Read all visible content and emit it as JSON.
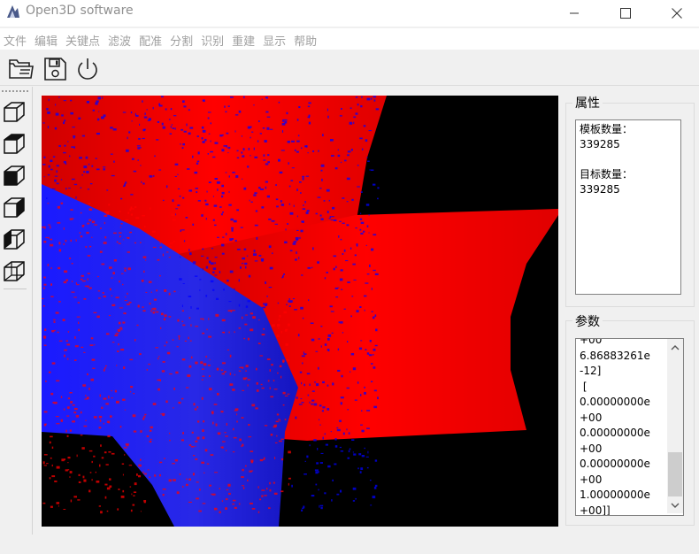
{
  "window": {
    "title": "Open3D software",
    "app_icon": "open3d-logo-icon",
    "controls": [
      "minimize-icon",
      "maximize-icon",
      "close-icon"
    ]
  },
  "menu": [
    "文件",
    "编辑",
    "关键点",
    "滤波",
    "配准",
    "分割",
    "识别",
    "重建",
    "显示",
    "帮助"
  ],
  "toolbar": {
    "buttons": [
      {
        "name": "open-folder-icon"
      },
      {
        "name": "save-disk-icon"
      },
      {
        "name": "power-icon"
      }
    ]
  },
  "view_buttons": [
    {
      "name": "cube-view-1-icon"
    },
    {
      "name": "cube-view-2-icon"
    },
    {
      "name": "cube-view-3-icon"
    },
    {
      "name": "cube-view-4-icon"
    },
    {
      "name": "cube-view-5-icon"
    },
    {
      "name": "cube-view-6-icon"
    }
  ],
  "viewport": {
    "background": "#000000",
    "colors": {
      "template": "#ff0000",
      "target": "#0000ff"
    }
  },
  "properties": {
    "title": "属性",
    "template_label": "模板数量：",
    "template_count": "339285",
    "target_label": "目标数量：",
    "target_count": "339285"
  },
  "parameters": {
    "title": "参数",
    "text": "+00\n6.86883261e\n-12]\n [\n0.00000000e\n+00\n0.00000000e\n+00\n0.00000000e\n+00\n1.00000000e\n+00]]"
  }
}
